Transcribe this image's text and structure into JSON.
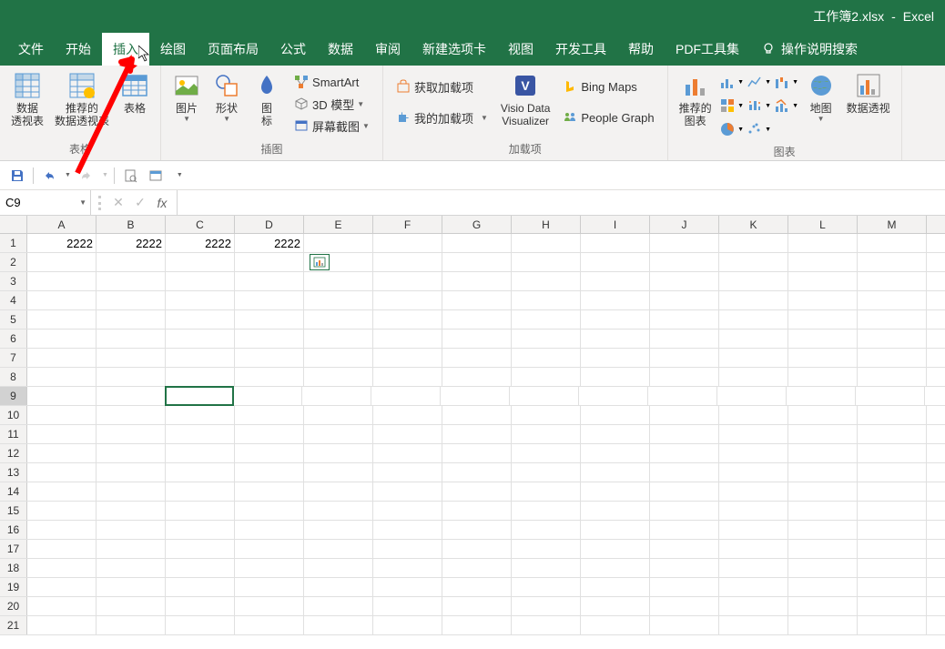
{
  "titlebar": {
    "filename": "工作簿2.xlsx",
    "dash": "-",
    "app": "Excel"
  },
  "tabs": [
    "文件",
    "开始",
    "插入",
    "绘图",
    "页面布局",
    "公式",
    "数据",
    "审阅",
    "新建选项卡",
    "视图",
    "开发工具",
    "帮助",
    "PDF工具集"
  ],
  "active_tab_index": 2,
  "search_help": "操作说明搜索",
  "ribbon": {
    "group1": {
      "label": "表格",
      "pivot": "数据\n透视表",
      "rec_pivot": "推荐的\n数据透视表",
      "table": "表格"
    },
    "group2": {
      "label": "插图",
      "pictures": "图片",
      "shapes": "形状",
      "icons": "图\n标",
      "smartart": "SmartArt",
      "model3d": "3D 模型",
      "screenshot": "屏幕截图"
    },
    "group3": {
      "label": "加载项",
      "get_addins": "获取加载项",
      "my_addins": "我的加载项",
      "visio": "Visio Data\nVisualizer",
      "bing": "Bing Maps",
      "people": "People Graph"
    },
    "group4": {
      "label": "图表",
      "rec_charts": "推荐的\n图表",
      "map": "地图",
      "pivot_chart": "数据透视"
    }
  },
  "name_box": "C9",
  "columns": [
    "A",
    "B",
    "C",
    "D",
    "E",
    "F",
    "G",
    "H",
    "I",
    "J",
    "K",
    "L",
    "M"
  ],
  "grid": {
    "rows": 21,
    "data": {
      "A1": "2222",
      "B1": "2222",
      "C1": "2222",
      "D1": "2222"
    },
    "selected": "C9"
  }
}
